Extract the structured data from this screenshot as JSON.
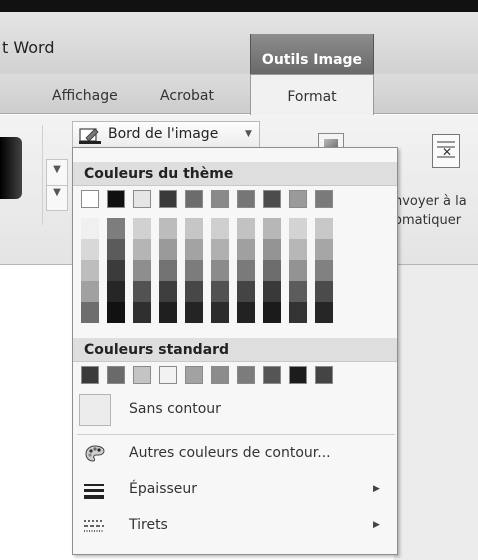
{
  "title_bar": {
    "app_title": "t Word",
    "context_tab": "Outils Image"
  },
  "tabs": {
    "affichage": "Affichage",
    "acrobat": "Acrobat",
    "format": "Format"
  },
  "ribbon": {
    "border_button_label": "Bord de l'image",
    "wrap_line1": "nvoyer à la",
    "wrap_line2": "omatiquer"
  },
  "dropdown": {
    "theme_header": "Couleurs du thème",
    "standard_header": "Couleurs standard",
    "theme_top_row": [
      "#ffffff",
      "#101010",
      "#e5e5e5",
      "#3a3a3a",
      "#6c6c6c",
      "#8a8a8a",
      "#767676",
      "#4c4c4c",
      "#9a9a9a",
      "#7a7a7a"
    ],
    "theme_columns": [
      [
        "#f0f0f0",
        "#d8d8d8",
        "#bdbdbd",
        "#a1a1a1",
        "#6e6e6e"
      ],
      [
        "#7d7d7d",
        "#5b5b5b",
        "#3b3b3b",
        "#262626",
        "#111111"
      ],
      [
        "#d1d1d1",
        "#b5b5b5",
        "#8e8e8e",
        "#525252",
        "#2f2f2f"
      ],
      [
        "#bcbcbc",
        "#9a9a9a",
        "#727272",
        "#3e3e3e",
        "#1f1f1f"
      ],
      [
        "#c6c6c6",
        "#a3a3a3",
        "#7c7c7c",
        "#474747",
        "#242424"
      ],
      [
        "#cfcfcf",
        "#b0b0b0",
        "#8b8b8b",
        "#525252",
        "#2c2c2c"
      ],
      [
        "#c2c2c2",
        "#a0a0a0",
        "#7a7a7a",
        "#444444",
        "#222222"
      ],
      [
        "#b7b7b7",
        "#949494",
        "#6d6d6d",
        "#393939",
        "#1b1b1b"
      ],
      [
        "#d3d3d3",
        "#b7b7b7",
        "#939393",
        "#5c5c5c",
        "#333333"
      ],
      [
        "#c8c8c8",
        "#a6a6a6",
        "#818181",
        "#4b4b4b",
        "#262626"
      ]
    ],
    "standard_colors": [
      "#3a3a3a",
      "#6a6a6a",
      "#c4c4c4",
      "#f2f2f2",
      "#a2a2a2",
      "#8c8c8c",
      "#7c7c7c",
      "#555555",
      "#1c1c1c",
      "#444444"
    ],
    "items": {
      "no_outline": "Sans contour",
      "more_colors": "Autres couleurs de contour...",
      "weight": "Épaisseur",
      "dashes": "Tirets"
    }
  },
  "icons": {
    "border_icon": "picture-border-pencil-icon",
    "more_colors_icon": "palette-icon",
    "weight_icon": "line-weight-icon",
    "dashes_icon": "dash-lines-icon",
    "submenu_arrow": "submenu-arrow-icon"
  }
}
